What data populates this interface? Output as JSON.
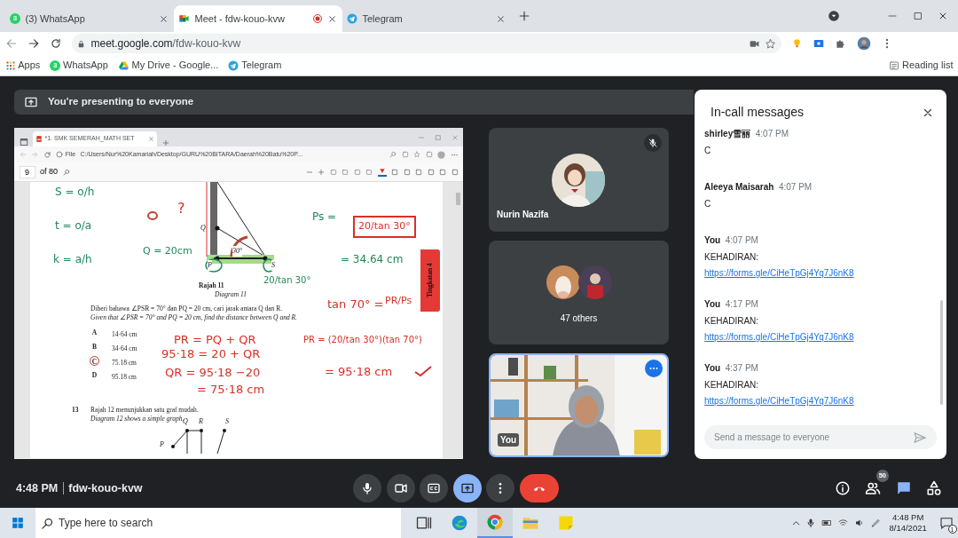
{
  "browser": {
    "tabs": [
      {
        "title": "(3) WhatsApp",
        "kind": "whatsapp",
        "badge": "3",
        "selected": false,
        "recording": false
      },
      {
        "title": "Meet - fdw-kouo-kvw",
        "kind": "meet",
        "selected": true,
        "recording": true
      },
      {
        "title": "Telegram",
        "kind": "telegram",
        "selected": false,
        "recording": false
      }
    ],
    "url_host": "meet.google.com",
    "url_path": "/fdw-kouo-kvw",
    "bookmarks": [
      {
        "label": "Apps",
        "kind": "apps"
      },
      {
        "label": "WhatsApp",
        "kind": "whatsapp",
        "badge": "3"
      },
      {
        "label": "My Drive - Google...",
        "kind": "drive"
      },
      {
        "label": "Telegram",
        "kind": "telegram"
      }
    ],
    "reading_list": "Reading list"
  },
  "meet": {
    "banner": "You're presenting to everyone",
    "shared_screen": {
      "viewer_tab": "*1. SMK SEMERAH_MATH SET",
      "file_label": "File",
      "path": "C:/Users/Nur%20Kamariah/Desktop/GURU%20BITARA/Daerah%20Batu%20P...",
      "page": "9",
      "page_count": "of 80",
      "document": {
        "diagram_labels": [
          "Q",
          "P",
          "S",
          "30°"
        ],
        "caption_ms": "Rajah 11",
        "caption_en": "Diagram 11",
        "question_ms": "Diberi bahawa ∠PSR = 70° dan PQ = 20 cm, cari jarak antara Q dan R.",
        "question_en": "Given that ∠PSR = 70° and PQ = 20 cm, find the distance between Q and R.",
        "options": [
          {
            "letter": "A",
            "text": "14·64 cm",
            "circled": false
          },
          {
            "letter": "B",
            "text": "34·64 cm",
            "circled": false
          },
          {
            "letter": "C",
            "text": "75.18 cm",
            "circled": true
          },
          {
            "letter": "D",
            "text": "95.18 cm",
            "circled": false
          }
        ],
        "next_number": "13",
        "next_ms": "Rajah 12 menunjukkan satu graf mudah.",
        "next_en": "Diagram 12 shows a simple graph.",
        "graph_labels": [
          "Q",
          "R",
          "S",
          "P"
        ],
        "handwriting": [
          {
            "text": "S = o/h",
            "color": "#1e8a5a"
          },
          {
            "text": "t = o/a",
            "color": "#1e8a5a"
          },
          {
            "text": "k = a/h",
            "color": "#1e8a5a"
          },
          {
            "text": "?",
            "color": "#d93025"
          },
          {
            "text": "Q = 20cm",
            "color": "#1e8a5a"
          },
          {
            "text": "Ps =",
            "color": "#1e8a5a"
          },
          {
            "text": "20/tan 30°",
            "color": "#d93025"
          },
          {
            "text": "= 34.64 cm",
            "color": "#1e8a5a"
          },
          {
            "text": "20/tan 30°",
            "color": "#1e8a5a"
          },
          {
            "text": "tan 70° =",
            "color": "#d93025"
          },
          {
            "text": "PR/Ps",
            "color": "#d93025"
          },
          {
            "text": "PR = PQ + QR",
            "color": "#d93025"
          },
          {
            "text": "95·18 = 20 + QR",
            "color": "#d93025"
          },
          {
            "text": "QR = 95·18 −20",
            "color": "#d93025"
          },
          {
            "text": "= 75·18 cm",
            "color": "#d93025"
          },
          {
            "text": "PR = (20/tan 30°)(tan 70°)",
            "color": "#d93025"
          },
          {
            "text": "= 95·18 cm",
            "color": "#d93025"
          }
        ]
      },
      "side_tab": "Tingkatan 4"
    },
    "tiles": [
      {
        "kind": "avatar",
        "name": "Nurin Nazifa",
        "muted": true
      },
      {
        "kind": "group",
        "label": "47 others"
      },
      {
        "kind": "self",
        "label": "You",
        "selected": true
      }
    ],
    "chat": {
      "title": "In-call messages",
      "messages": [
        {
          "sender": "shirley雪丽",
          "time": "4:07 PM",
          "text": "C"
        },
        {
          "sender": "Aleeya Maisarah",
          "time": "4:07 PM",
          "text": "C"
        },
        {
          "sender": "You",
          "time": "4:07 PM",
          "text": "KEHADIRAN:",
          "link": "https://forms.gle/CiHeTpGj4Yq7J6nK8"
        },
        {
          "sender": "You",
          "time": "4:17 PM",
          "text": "KEHADIRAN:",
          "link": "https://forms.gle/CiHeTpGj4Yq7J6nK8"
        },
        {
          "sender": "You",
          "time": "4:37 PM",
          "text": "KEHADIRAN:",
          "link": "https://forms.gle/CiHeTpGj4Yq7J6nK8"
        }
      ],
      "placeholder": "Send a message to everyone"
    },
    "time": "4:48 PM",
    "code": "fdw-kouo-kvw",
    "controls": [
      {
        "kind": "mic",
        "active": false
      },
      {
        "kind": "camera",
        "active": false
      },
      {
        "kind": "captions",
        "active": false
      },
      {
        "kind": "present",
        "active": true
      },
      {
        "kind": "more",
        "active": false
      },
      {
        "kind": "hangup",
        "active": false
      }
    ],
    "side_buttons": [
      {
        "kind": "info",
        "selected": false
      },
      {
        "kind": "people",
        "selected": false,
        "count": "50"
      },
      {
        "kind": "chat",
        "selected": true
      },
      {
        "kind": "activities",
        "selected": false
      }
    ]
  },
  "taskbar": {
    "search_placeholder": "Type here to search",
    "apps": [
      {
        "kind": "taskview",
        "selected": false
      },
      {
        "kind": "edge",
        "selected": false
      },
      {
        "kind": "chrome",
        "selected": true
      },
      {
        "kind": "explorer",
        "selected": false
      },
      {
        "kind": "sticky",
        "selected": false
      }
    ],
    "time": "4:48 PM",
    "date": "8/14/2021",
    "notifications": "1"
  }
}
